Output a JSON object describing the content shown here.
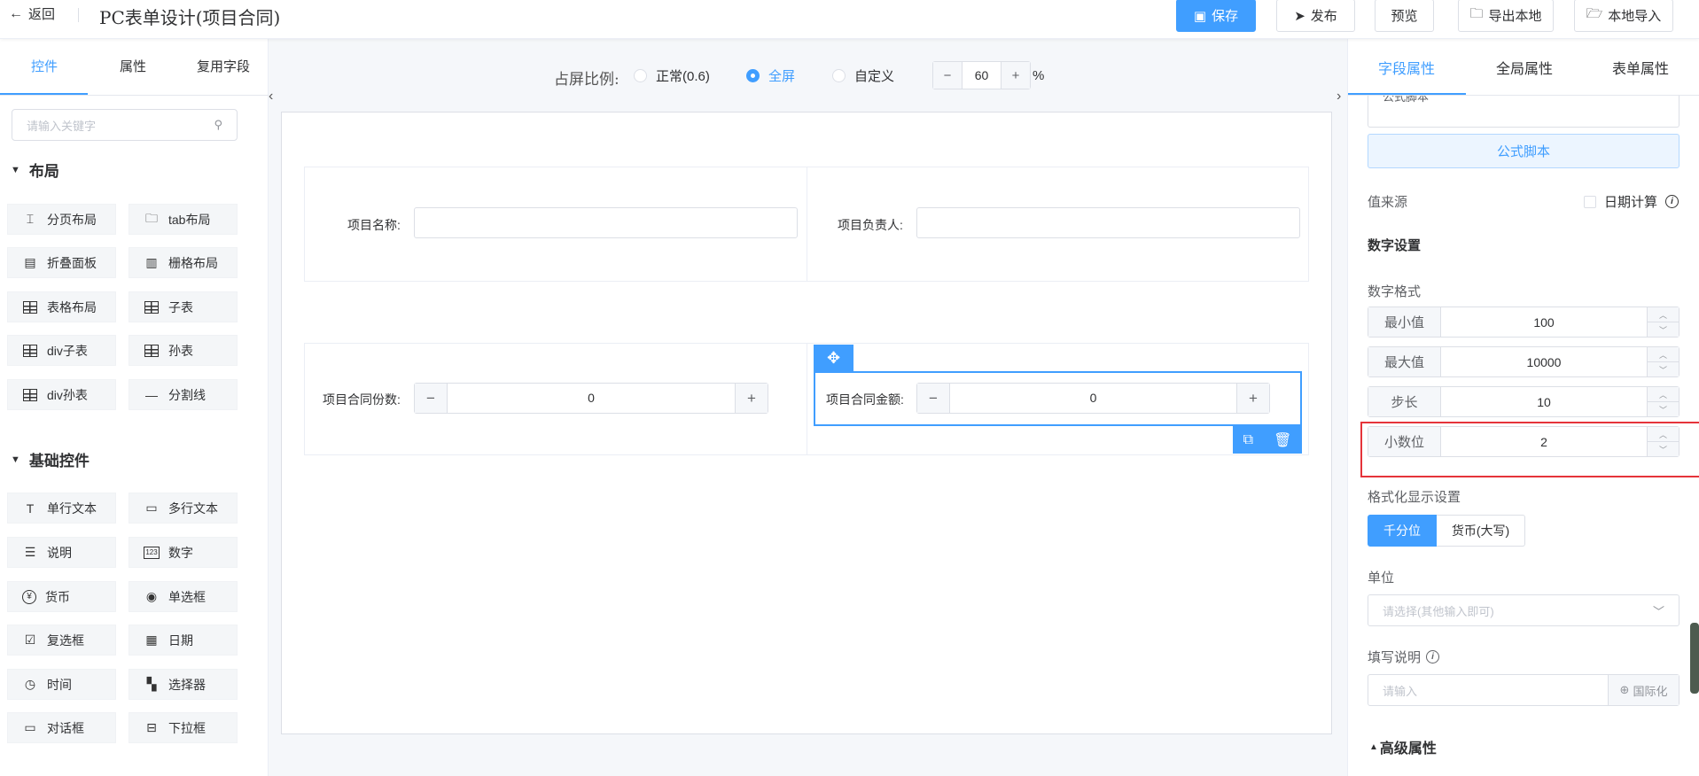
{
  "header": {
    "back_label": "返回",
    "title": "PC表单设计(项目合同)",
    "save_label": "保存",
    "publish_label": "发布",
    "preview_label": "预览",
    "export_label": "导出本地",
    "import_label": "本地导入"
  },
  "left": {
    "tabs": [
      "控件",
      "属性",
      "复用字段"
    ],
    "search_placeholder": "请输入关键字",
    "layout_title": "布局",
    "layout_items": [
      "分页布局",
      "tab布局",
      "折叠面板",
      "栅格布局",
      "表格布局",
      "子表",
      "div子表",
      "孙表",
      "div孙表",
      "分割线"
    ],
    "basic_title": "基础控件",
    "basic_items": [
      "单行文本",
      "多行文本",
      "说明",
      "数字",
      "货币",
      "单选框",
      "复选框",
      "日期",
      "时间",
      "选择器",
      "对话框",
      "下拉框"
    ]
  },
  "center": {
    "ratio_label": "占屏比例:",
    "ratio_options": [
      "正常(0.6)",
      "全屏",
      "自定义"
    ],
    "selected_ratio": "全屏",
    "zoom_value": "60",
    "zoom_unit": "%",
    "fields": {
      "project_name_label": "项目名称:",
      "project_owner_label": "项目负责人:",
      "contract_count_label": "项目合同份数:",
      "contract_count_value": "0",
      "contract_amount_label": "项目合同金额:",
      "contract_amount_value": "0"
    }
  },
  "right": {
    "tabs": [
      "字段属性",
      "全局属性",
      "表单属性"
    ],
    "partial_select_text": "公式脚本",
    "formula_button": "公式脚本",
    "value_source_label": "值来源",
    "date_calc_label": "日期计算",
    "number_settings_title": "数字设置",
    "number_format_label": "数字格式",
    "min_label": "最小值",
    "min_value": "100",
    "max_label": "最大值",
    "max_value": "10000",
    "step_label": "步长",
    "step_value": "10",
    "decimal_label": "小数位",
    "decimal_value": "2",
    "format_display_label": "格式化显示设置",
    "format_options": [
      "千分位",
      "货币(大写)"
    ],
    "unit_label": "单位",
    "unit_placeholder": "请选择(其他输入即可)",
    "desc_label": "填写说明",
    "desc_placeholder": "请输入",
    "i18n_label": "国际化",
    "advanced_label": "高级属性"
  },
  "colors": {
    "primary": "#409eff",
    "highlight": "#e5333a"
  }
}
